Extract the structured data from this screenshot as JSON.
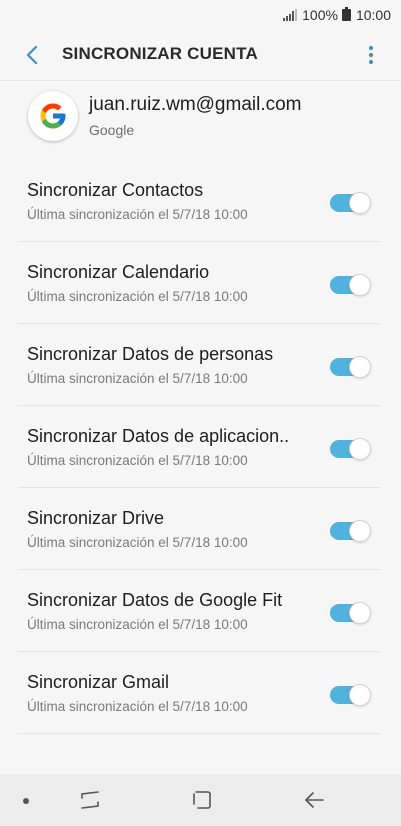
{
  "status_bar": {
    "battery": "100%",
    "time": "10:00"
  },
  "app_bar": {
    "title": "SINCRONIZAR CUENTA"
  },
  "account": {
    "email": "juan.ruiz.wm@gmail.com",
    "provider": "Google"
  },
  "sync_items": [
    {
      "label": "Sincronizar Contactos",
      "last_sync": "Última sincronización el 5/7/18  10:00",
      "enabled": true
    },
    {
      "label": "Sincronizar Calendario",
      "last_sync": "Última sincronización el 5/7/18  10:00",
      "enabled": true
    },
    {
      "label": "Sincronizar Datos de personas",
      "last_sync": "Última sincronización el 5/7/18  10:00",
      "enabled": true
    },
    {
      "label": "Sincronizar Datos de aplicacion..",
      "last_sync": "Última sincronización el 5/7/18  10:00",
      "enabled": true
    },
    {
      "label": "Sincronizar Drive",
      "last_sync": "Última sincronización el 5/7/18  10:00",
      "enabled": true
    },
    {
      "label": "Sincronizar Datos de Google Fit",
      "last_sync": "Última sincronización el 5/7/18  10:00",
      "enabled": true
    },
    {
      "label": "Sincronizar Gmail",
      "last_sync": "Última sincronización el 5/7/18  10:00",
      "enabled": true
    }
  ],
  "colors": {
    "accent": "#4fb3de",
    "icon_accent": "#3a8dc7"
  },
  "icons": {
    "back": "back-arrow-icon",
    "more": "more-vert-icon",
    "signal": "signal-icon",
    "battery": "battery-icon",
    "recents": "recents-icon",
    "home": "home-icon",
    "nav_back": "nav-back-icon"
  }
}
